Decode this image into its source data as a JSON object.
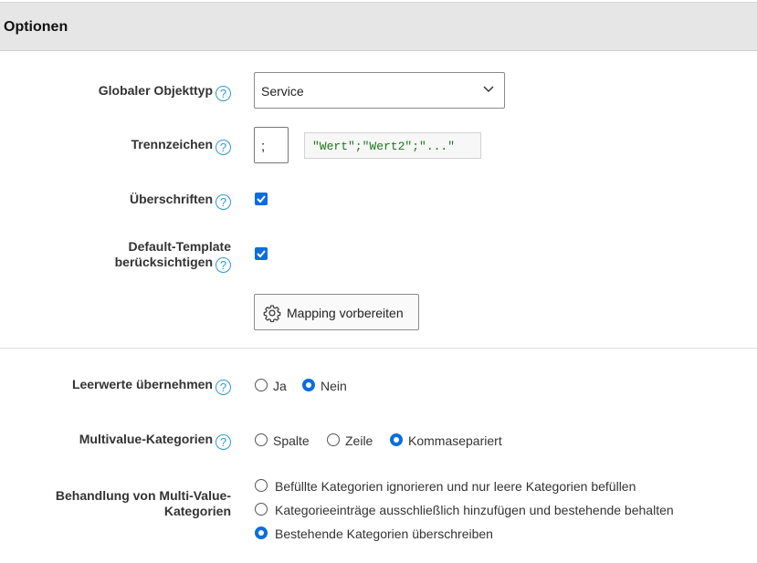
{
  "header": {
    "title": "Optionen"
  },
  "fields": {
    "objekttyp": {
      "label": "Globaler Objekttyp",
      "value": "Service"
    },
    "trennzeichen": {
      "label": "Trennzeichen",
      "value": ";",
      "sample": "\"Wert\";\"Wert2\";\"...\""
    },
    "ueberschriften": {
      "label": "Überschriften",
      "checked": true
    },
    "default_template": {
      "label_line1": "Default-Template",
      "label_line2": "berücksichtigen",
      "checked": true
    },
    "mapping_button": {
      "label": "Mapping vorbereiten"
    },
    "leerwerte": {
      "label": "Leerwerte übernehmen",
      "options": [
        "Ja",
        "Nein"
      ],
      "selected": "Nein"
    },
    "multivalue": {
      "label": "Multivalue-Kategorien",
      "options": [
        "Spalte",
        "Zeile",
        "Kommasepariert"
      ],
      "selected": "Kommasepariert"
    },
    "behandlung": {
      "label_line1": "Behandlung von Multi-Value-",
      "label_line2": "Kategorien",
      "options": [
        "Befüllte Kategorien ignorieren und nur leere Kategorien befüllen",
        "Kategorieeinträge ausschließlich hinzufügen und bestehende behalten",
        "Bestehende Kategorien überschreiben"
      ],
      "selected": "Bestehende Kategorien überschreiben"
    }
  },
  "help_icon_glyph": "?",
  "accent_color": "#0b6ede",
  "help_color": "#2e9ad0"
}
